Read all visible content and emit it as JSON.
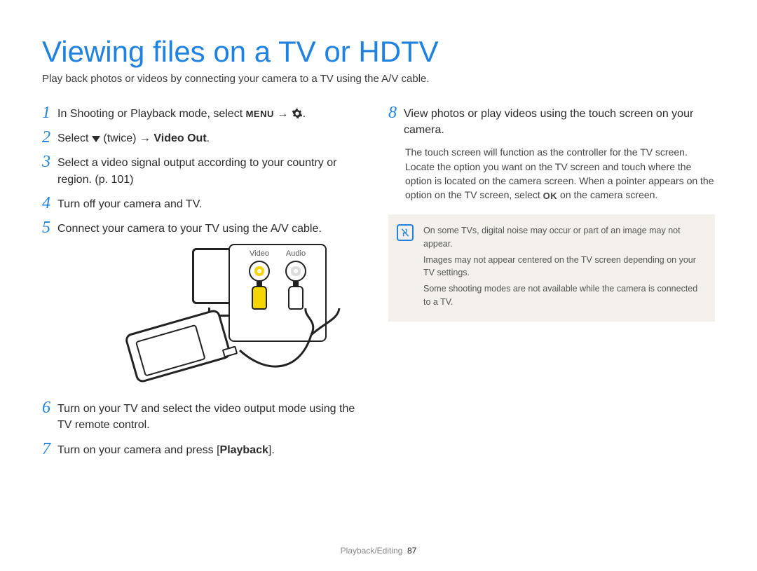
{
  "title": "Viewing files on a TV or HDTV",
  "subtitle": "Play back photos or videos by connecting your camera to a TV using the A/V cable.",
  "steps": {
    "s1_a": "In Shooting or Playback mode, select ",
    "s1_menu": "MENU",
    "s1_arrow": " → ",
    "s1_end": ".",
    "s2_a": "Select ",
    "s2_twice": " (twice) → ",
    "s2_bold": "Video Out",
    "s2_end": ".",
    "s3": "Select a video signal output according to your country or region. (p. 101)",
    "s4": "Turn off your camera and TV.",
    "s5": "Connect your camera to your TV using the A/V cable.",
    "s6": "Turn on your TV and select the video output mode using the TV remote control.",
    "s7_a": "Turn on your camera and press [",
    "s7_bold": "Playback",
    "s7_b": "].",
    "s8": "View photos or play videos using the touch screen on your camera."
  },
  "diagram": {
    "video_label": "Video",
    "audio_label": "Audio"
  },
  "substep8_a": "The touch screen will function as the controller for the TV screen. Locate the option you want on the TV screen and touch where the option is located on the camera screen. When a pointer appears on the option on the TV screen, select ",
  "substep8_ok": "OK",
  "substep8_b": " on the camera screen.",
  "notes": {
    "n1": "On some TVs, digital noise may occur or part of an image may not appear.",
    "n2": "Images may not appear centered on the TV screen depending on your TV settings.",
    "n3": "Some shooting modes are not available while the camera is connected to a TV."
  },
  "footer": {
    "section": "Playback/Editing",
    "page": "87"
  }
}
